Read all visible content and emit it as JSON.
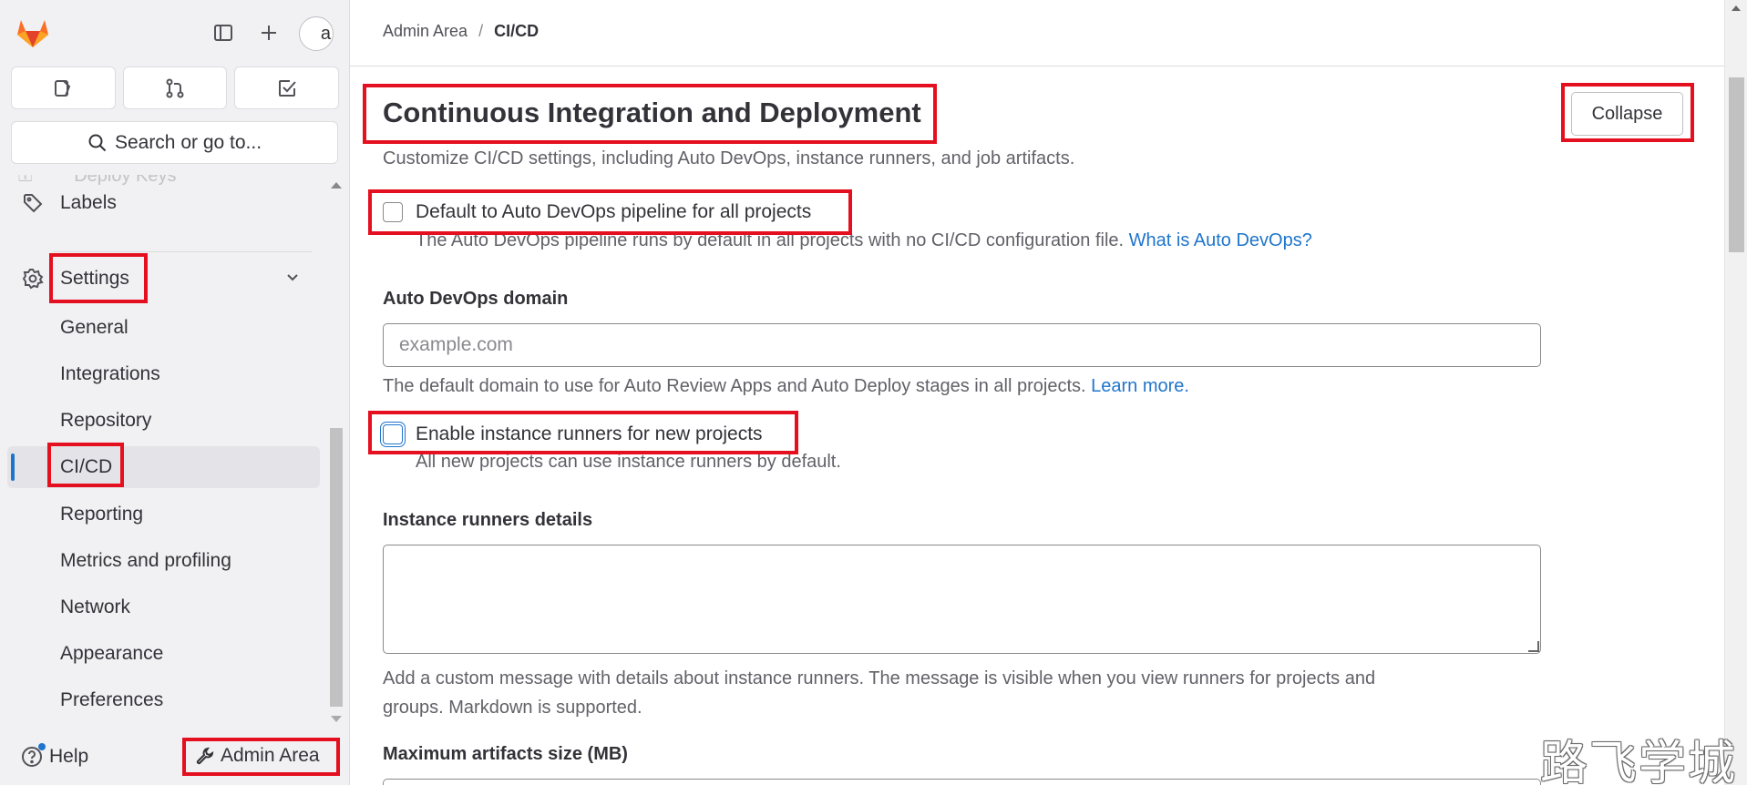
{
  "sidebar": {
    "search_label": "Search or go to...",
    "faded_item": "Deploy Keys",
    "labels_item": "Labels",
    "settings_item": "Settings",
    "settings_children": [
      {
        "label": "General"
      },
      {
        "label": "Integrations"
      },
      {
        "label": "Repository"
      },
      {
        "label": "CI/CD"
      },
      {
        "label": "Reporting"
      },
      {
        "label": "Metrics and profiling"
      },
      {
        "label": "Network"
      },
      {
        "label": "Appearance"
      },
      {
        "label": "Preferences"
      }
    ],
    "active_item": "CI/CD",
    "help_label": "Help",
    "admin_label": "Admin Area",
    "avatar_alt": "a"
  },
  "breadcrumb": {
    "root": "Admin Area",
    "separator": "/",
    "current": "CI/CD"
  },
  "section": {
    "title": "Continuous Integration and Deployment",
    "description": "Customize CI/CD settings, including Auto DevOps, instance runners, and job artifacts.",
    "collapse_label": "Collapse"
  },
  "form": {
    "auto_devops": {
      "label": "Default to Auto DevOps pipeline for all projects",
      "checked": false,
      "help": "The Auto DevOps pipeline runs by default in all projects with no CI/CD configuration file.",
      "help_link": "What is Auto DevOps?"
    },
    "domain": {
      "label": "Auto DevOps domain",
      "placeholder": "example.com",
      "value": "",
      "help": "The default domain to use for Auto Review Apps and Auto Deploy stages in all projects.",
      "help_link": "Learn more."
    },
    "instance_runners": {
      "label": "Enable instance runners for new projects",
      "checked": false,
      "help": "All new projects can use instance runners by default."
    },
    "runner_details": {
      "label": "Instance runners details",
      "value": "",
      "help_line1": "Add a custom message with details about instance runners. The message is visible when you view runners for projects and",
      "help_line2": "groups. Markdown is supported."
    },
    "max_artifacts": {
      "label": "Maximum artifacts size (MB)"
    }
  },
  "watermark": "路飞学城",
  "colors": {
    "accent": "#1f75cb",
    "annotation": "#e4101f",
    "sidebar_bg": "#f1f1f4"
  },
  "icons": [
    "gitlab-logo-icon",
    "sidebar-toggle-icon",
    "plus-icon",
    "issues-icon",
    "merge-request-icon",
    "todo-icon",
    "search-icon",
    "label-icon",
    "gear-icon",
    "chevron-down-icon",
    "help-icon",
    "wrench-icon"
  ]
}
